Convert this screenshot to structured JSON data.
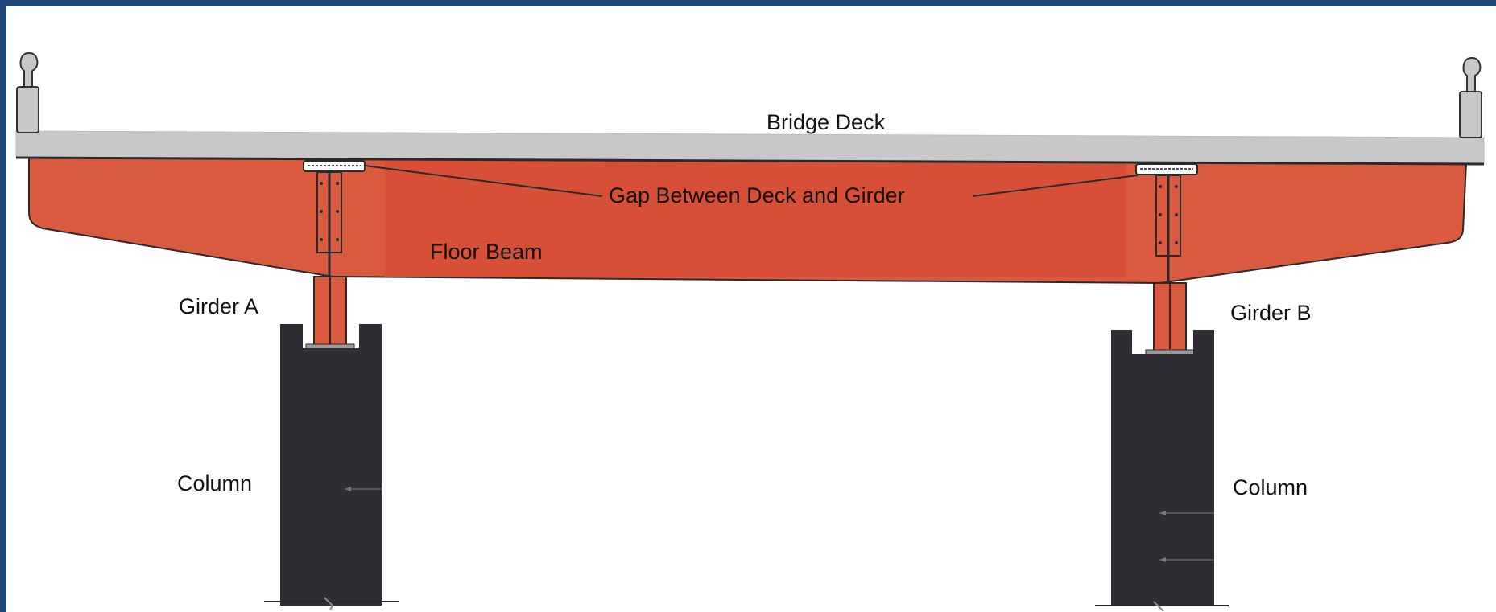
{
  "diagram": {
    "labels": {
      "bridge_deck": "Bridge  Deck",
      "gap": "Gap Between Deck and Girder",
      "floor_beam": "Floor Beam",
      "girder_a": "Girder A",
      "girder_b": "Girder B",
      "column_left": "Column",
      "column_right": "Column"
    },
    "colors": {
      "frame": "#1f4778",
      "background": "#ffffff",
      "deck": "#c8c8cb",
      "floor_beam": "#d95a3e",
      "floor_beam_inner": "#d84f37",
      "column": "#2f2c33",
      "outline": "#2a2a2a"
    }
  }
}
